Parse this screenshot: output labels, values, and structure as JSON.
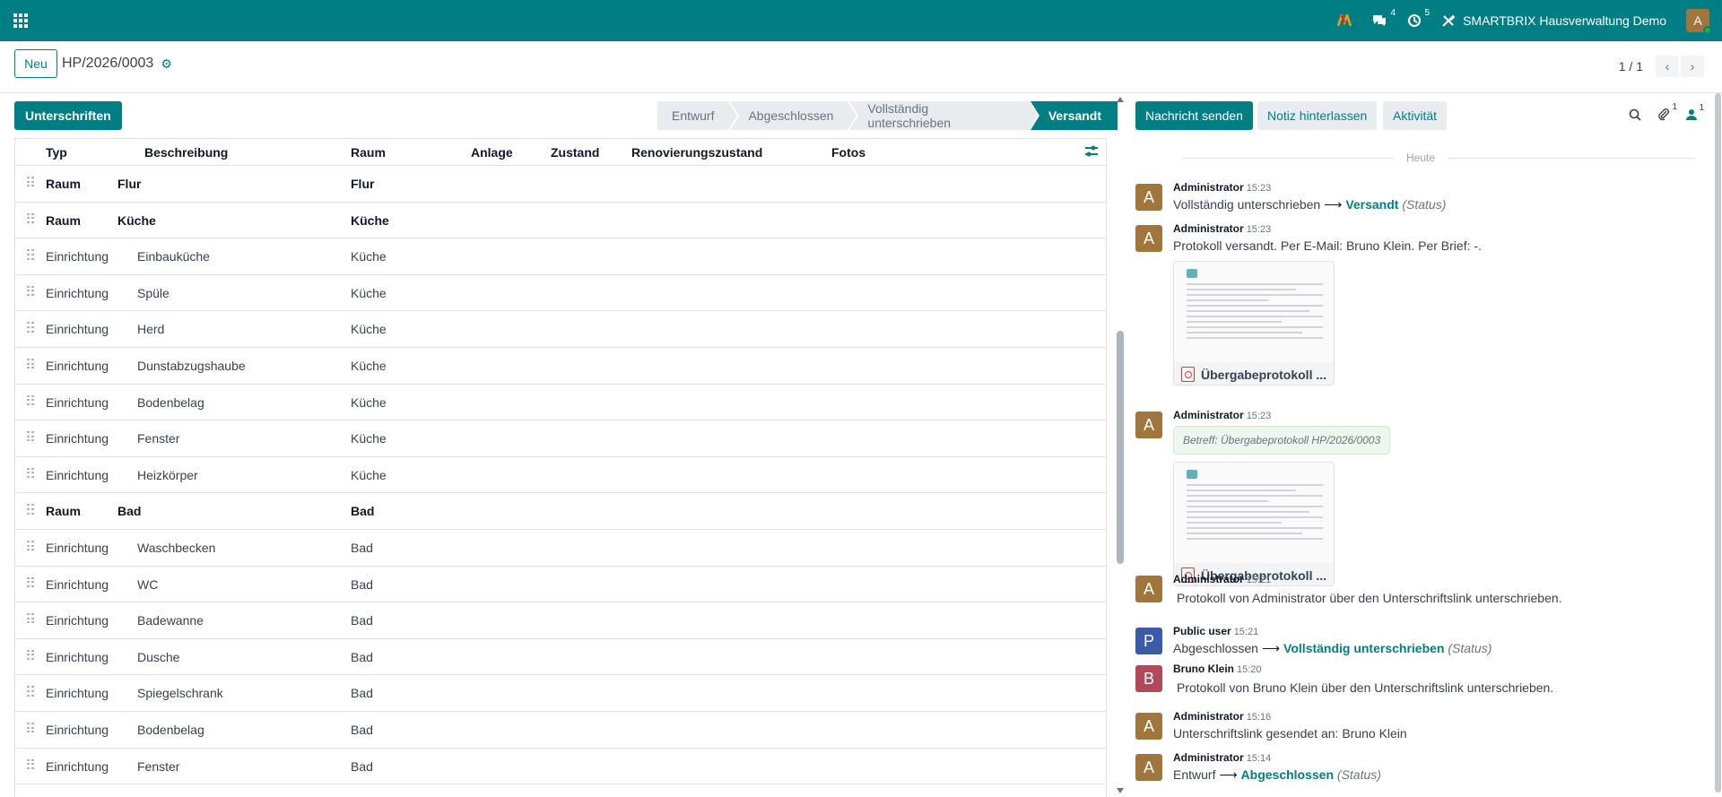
{
  "topbar": {
    "messages_count": "4",
    "activities_count": "5",
    "company": "SMARTBRIX Hausverwaltung Demo",
    "user_initial": "A",
    "colors": {
      "brand": "#017e84"
    }
  },
  "control": {
    "new_label": "Neu",
    "record_name": "HP/2026/0003",
    "pager": "1 / 1"
  },
  "form": {
    "signatures_button": "Unterschriften",
    "stages": [
      "Entwurf",
      "Abgeschlossen",
      "Vollständig unterschrieben",
      "Versandt"
    ],
    "active_stage": "Versandt",
    "columns": [
      "Typ",
      "Beschreibung",
      "Raum",
      "Anlage",
      "Zustand",
      "Renovierungszustand",
      "Fotos"
    ],
    "rows": [
      {
        "typ": "Raum",
        "beschreibung": "Flur",
        "raum": "Flur",
        "section": true
      },
      {
        "typ": "Raum",
        "beschreibung": "Küche",
        "raum": "Küche",
        "section": true
      },
      {
        "typ": "Einrichtung",
        "beschreibung": "Einbauküche",
        "raum": "Küche"
      },
      {
        "typ": "Einrichtung",
        "beschreibung": "Spüle",
        "raum": "Küche"
      },
      {
        "typ": "Einrichtung",
        "beschreibung": "Herd",
        "raum": "Küche"
      },
      {
        "typ": "Einrichtung",
        "beschreibung": "Dunstabzugshaube",
        "raum": "Küche"
      },
      {
        "typ": "Einrichtung",
        "beschreibung": "Bodenbelag",
        "raum": "Küche"
      },
      {
        "typ": "Einrichtung",
        "beschreibung": "Fenster",
        "raum": "Küche"
      },
      {
        "typ": "Einrichtung",
        "beschreibung": "Heizkörper",
        "raum": "Küche"
      },
      {
        "typ": "Raum",
        "beschreibung": "Bad",
        "raum": "Bad",
        "section": true
      },
      {
        "typ": "Einrichtung",
        "beschreibung": "Waschbecken",
        "raum": "Bad"
      },
      {
        "typ": "Einrichtung",
        "beschreibung": "WC",
        "raum": "Bad"
      },
      {
        "typ": "Einrichtung",
        "beschreibung": "Badewanne",
        "raum": "Bad"
      },
      {
        "typ": "Einrichtung",
        "beschreibung": "Dusche",
        "raum": "Bad"
      },
      {
        "typ": "Einrichtung",
        "beschreibung": "Spiegelschrank",
        "raum": "Bad"
      },
      {
        "typ": "Einrichtung",
        "beschreibung": "Bodenbelag",
        "raum": "Bad"
      },
      {
        "typ": "Einrichtung",
        "beschreibung": "Fenster",
        "raum": "Bad"
      }
    ]
  },
  "chatter": {
    "send_message": "Nachricht senden",
    "log_note": "Notiz hinterlassen",
    "activity": "Aktivität",
    "attachments_count": "1",
    "followers_count": "1",
    "day_label": "Heute",
    "messages": {
      "m1": {
        "author": "Administrator",
        "time": "15:23",
        "old": "Vollständig unterschrieben",
        "new": "Versandt",
        "field": "(Status)",
        "initial": "A",
        "color": "#a0763c"
      },
      "m2": {
        "author": "Administrator",
        "time": "15:23",
        "body": "Protokoll versandt. Per E-Mail: Bruno Klein. Per Brief: -.",
        "attachment": "Übergabeprotokoll ...",
        "initial": "A",
        "color": "#a0763c"
      },
      "m3": {
        "author": "Administrator",
        "time": "15:23",
        "subject": "Betreff: Übergabeprotokoll HP/2026/0003",
        "attachment": "Übergabeprotokoll ...",
        "initial": "A",
        "color": "#a0763c"
      },
      "m4": {
        "author": "Administrator",
        "time": "15:21",
        "body": "Protokoll von Administrator über den Unterschriftslink unterschrieben.",
        "initial": "A",
        "color": "#a0763c"
      },
      "m5": {
        "author": "Public user",
        "time": "15:21",
        "old": "Abgeschlossen",
        "new": "Vollständig unterschrieben",
        "field": "(Status)",
        "initial": "P",
        "color": "#3b5aa8"
      },
      "m6": {
        "author": "Bruno Klein",
        "time": "15:20",
        "body": "Protokoll von Bruno Klein über den Unterschriftslink unterschrieben.",
        "initial": "B",
        "color": "#b04a5a"
      },
      "m7": {
        "author": "Administrator",
        "time": "15:16",
        "body": "Unterschriftslink gesendet an: Bruno Klein",
        "initial": "A",
        "color": "#a0763c"
      },
      "m8": {
        "author": "Administrator",
        "time": "15:14",
        "old": "Entwurf",
        "new": "Abgeschlossen",
        "field": "(Status)",
        "initial": "A",
        "color": "#a0763c"
      }
    }
  }
}
